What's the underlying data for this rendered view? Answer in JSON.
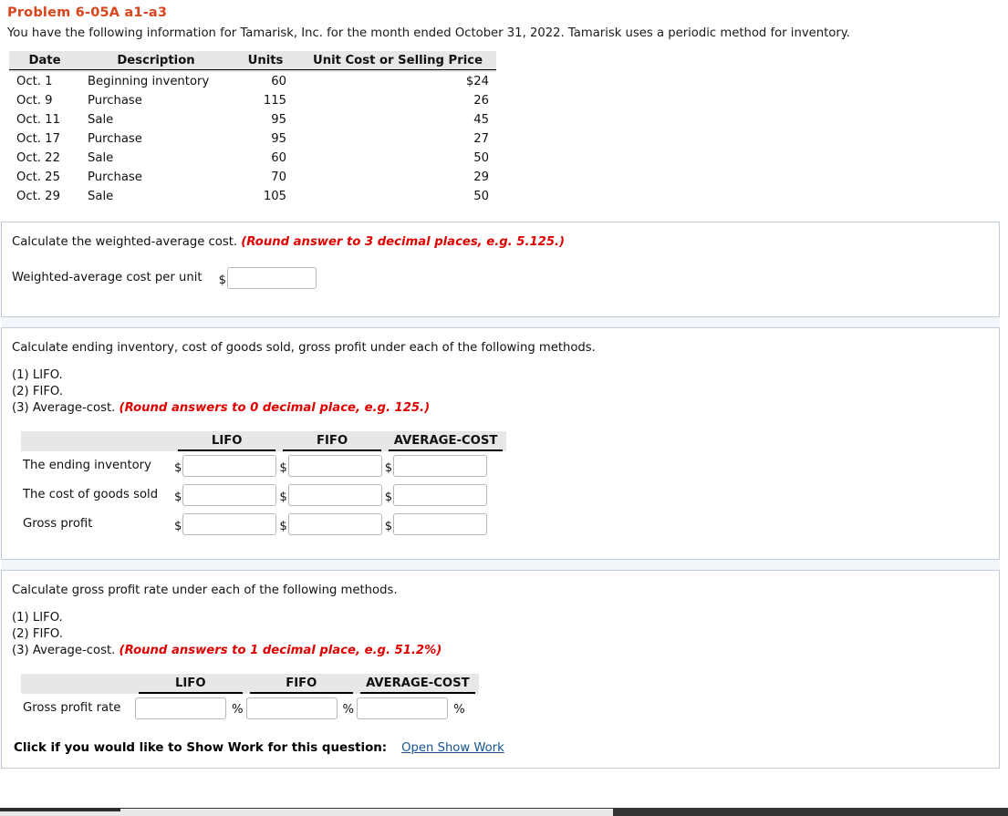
{
  "header": {
    "title": "Problem 6-05A a1-a3",
    "intro": "You have the following information for Tamarisk, Inc. for the month ended October 31, 2022. Tamarisk uses a periodic method for inventory.",
    "title_color": "#d8451c"
  },
  "inventory_table": {
    "columns": [
      "Date",
      "Description",
      "Units",
      "Unit Cost or Selling Price"
    ],
    "rows": [
      {
        "date": "Oct. 1",
        "description": "Beginning inventory",
        "units": "60",
        "price": "$24"
      },
      {
        "date": "Oct. 9",
        "description": "Purchase",
        "units": "115",
        "price": "26"
      },
      {
        "date": "Oct. 11",
        "description": "Sale",
        "units": "95",
        "price": "45"
      },
      {
        "date": "Oct. 17",
        "description": "Purchase",
        "units": "95",
        "price": "27"
      },
      {
        "date": "Oct. 22",
        "description": "Sale",
        "units": "60",
        "price": "50"
      },
      {
        "date": "Oct. 25",
        "description": "Purchase",
        "units": "70",
        "price": "29"
      },
      {
        "date": "Oct. 29",
        "description": "Sale",
        "units": "105",
        "price": "50"
      }
    ]
  },
  "section_wavg": {
    "prompt": "Calculate the weighted-average cost.",
    "hint": "(Round answer to 3 decimal places, e.g. 5.125.)",
    "row_label": "Weighted-average cost per unit",
    "currency_symbol": "$",
    "input_value": "",
    "input_placeholder": ""
  },
  "section_methods": {
    "prompt": "Calculate ending inventory, cost of goods sold, gross profit under each of the following methods.",
    "methods": [
      "(1) LIFO.",
      "(2) FIFO.",
      "(3) Average-cost."
    ],
    "hint": "(Round answers to 0 decimal place, e.g. 125.)",
    "columns": [
      "LIFO",
      "FIFO",
      "AVERAGE-COST"
    ],
    "currency_symbol": "$",
    "rows": [
      {
        "label": "The ending inventory",
        "values": [
          "",
          "",
          ""
        ]
      },
      {
        "label": "The cost of goods sold",
        "values": [
          "",
          "",
          ""
        ]
      },
      {
        "label": "Gross profit",
        "values": [
          "",
          "",
          ""
        ]
      }
    ]
  },
  "section_rate": {
    "prompt": "Calculate gross profit rate under each of the following methods.",
    "methods": [
      "(1) LIFO.",
      "(2) FIFO.",
      "(3) Average-cost."
    ],
    "hint": "(Round answers to 1 decimal place, e.g. 51.2%)",
    "columns": [
      "LIFO",
      "FIFO",
      "AVERAGE-COST"
    ],
    "percent_symbol": "%",
    "rows": [
      {
        "label": "Gross profit rate",
        "values": [
          "",
          "",
          ""
        ]
      }
    ]
  },
  "show_work": {
    "label": "Click if you would like to Show Work for this question:",
    "link": "Open Show Work"
  }
}
